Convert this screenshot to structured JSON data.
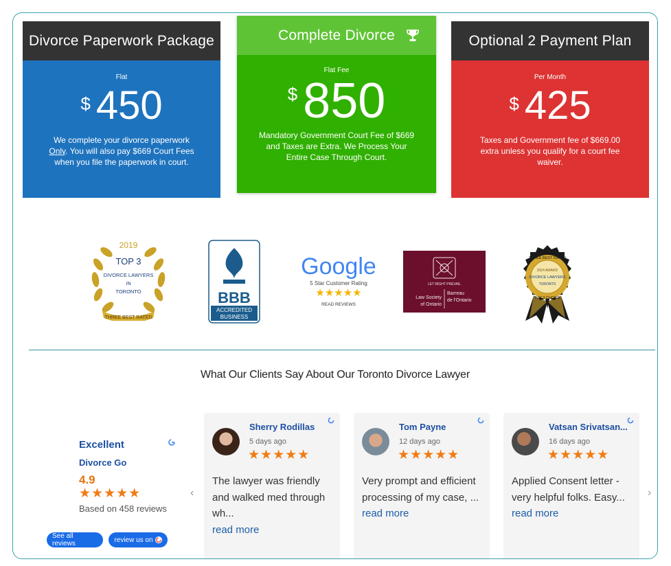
{
  "plans": [
    {
      "title": "Divorce Paperwork Package",
      "sub": "Flat",
      "currency": "$",
      "amount": "450",
      "desc_a": "We complete your divorce paperwork ",
      "desc_u": "Only",
      "desc_b": ". You will also pay $669 Court Fees when you file the paperwork in court."
    },
    {
      "title": "Complete Divorce",
      "sub": "Flat Fee",
      "currency": "$",
      "amount": "850",
      "desc": "Mandatory Government Court Fee of $669 and Taxes are Extra. We Process Your Entire Case Through Court."
    },
    {
      "title": "Optional 2 Payment Plan",
      "sub": "Per Month",
      "currency": "$",
      "amount": "425",
      "desc": "Taxes and Government fee of $669.00 extra unless you qualify for a court fee waiver."
    }
  ],
  "badges": {
    "threebest": {
      "year": "2019",
      "top": "TOP 3",
      "line1": "DIVORCE LAWYERS",
      "line2": "IN",
      "line3": "TORONTO",
      "ribbon": "THREE BEST RATED"
    },
    "bbb": {
      "logo": "BBB",
      "line1": "ACCREDITED",
      "line2": "BUSINESS"
    },
    "google": {
      "word": "Google",
      "tag": "5 Star Customer Rating",
      "stars": "★★★★★",
      "link": "READ REVIEWS"
    },
    "lawsociety": {
      "motto": "LET RIGHT PREVAIL",
      "en1": "Law Society",
      "en2": "of Ontario",
      "fr1": "Barreau",
      "fr2": "de l'Ontario"
    },
    "award": {
      "ring": "THREE BEST RATED",
      "year": "2024 AWARD",
      "line1": "DIVORCE LAWYERS",
      "line2": "TORONTO",
      "ribbon": "TOP 3 CHOICE"
    }
  },
  "reviews_heading": "What Our Clients Say About Our Toronto Divorce Lawyer",
  "summary": {
    "title": "Excellent",
    "name": "Divorce Go",
    "rating": "4.9",
    "stars": "★★★★★",
    "based": "Based on 458 reviews",
    "see_all": "See all reviews",
    "review_us": "review us on"
  },
  "reviews": [
    {
      "name": "Sherry Rodillas",
      "time": "5 days ago",
      "stars": "★★★★★",
      "text": "The lawyer was friendly and walked med through wh...",
      "more": "read more"
    },
    {
      "name": "Tom Payne",
      "time": "12 days ago",
      "stars": "★★★★★",
      "text": "Very prompt and efficient processing of my case, ...",
      "more": "read more"
    },
    {
      "name": "Vatsan Srivatsan...",
      "time": "16 days ago",
      "stars": "★★★★★",
      "text": "Applied Consent letter - very helpful folks. Easy...",
      "more": "read more"
    }
  ],
  "icons": {
    "prev": "chevron-left-icon",
    "next": "chevron-right-icon",
    "trophy": "trophy-icon",
    "google": "google-g-icon"
  },
  "colors": {
    "blue": "#1e73be",
    "green": "#30b000",
    "red": "#dd3333",
    "dark": "#333333",
    "accent": "#1a6be6",
    "star": "#f07c14"
  }
}
